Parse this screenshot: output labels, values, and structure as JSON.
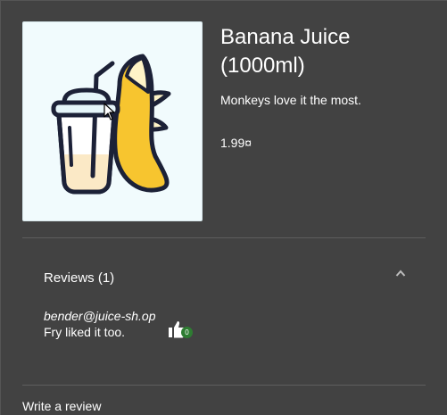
{
  "product": {
    "name": "Banana Juice (1000ml)",
    "description": "Monkeys love it the most.",
    "price": "1.99¤"
  },
  "reviews": {
    "title": "Reviews (1)",
    "expanded": true,
    "items": [
      {
        "author": "bender@juice-sh.op",
        "text": "Fry liked it too.",
        "likes": "0"
      }
    ]
  },
  "write_review": {
    "label": "Write a review"
  },
  "colors": {
    "dialog_background": "#424242",
    "like_badge": "#2e7d32",
    "banana": "#f7c52f",
    "juice": "#fbe9c6",
    "outline": "#1c2137"
  }
}
